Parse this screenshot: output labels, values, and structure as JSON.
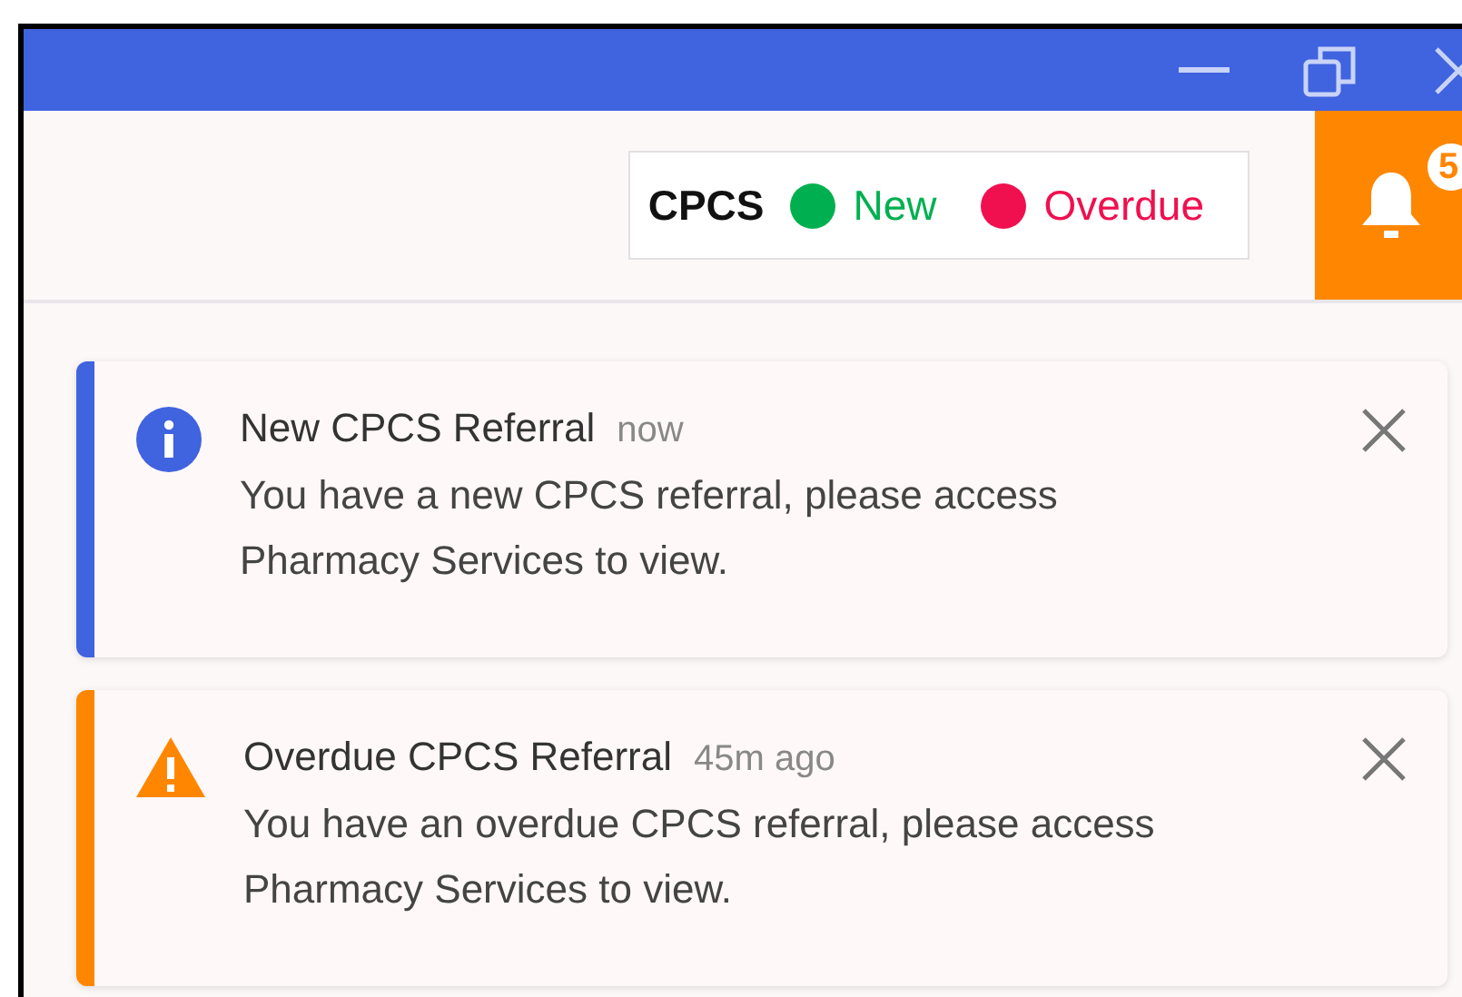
{
  "legend": {
    "title": "CPCS",
    "items": [
      {
        "label": "New",
        "color": "#00b050"
      },
      {
        "label": "Overdue",
        "color": "#f0104f"
      }
    ]
  },
  "bell": {
    "badge": "5"
  },
  "notifications": [
    {
      "kind": "info",
      "title": "New CPCS Referral",
      "time": "now",
      "message": "You have a new CPCS referral, please access Pharmacy Services to view."
    },
    {
      "kind": "warning",
      "title": "Overdue CPCS Referral",
      "time": "45m ago",
      "message": "You have an overdue CPCS referral, please access Pharmacy Services to view."
    }
  ]
}
